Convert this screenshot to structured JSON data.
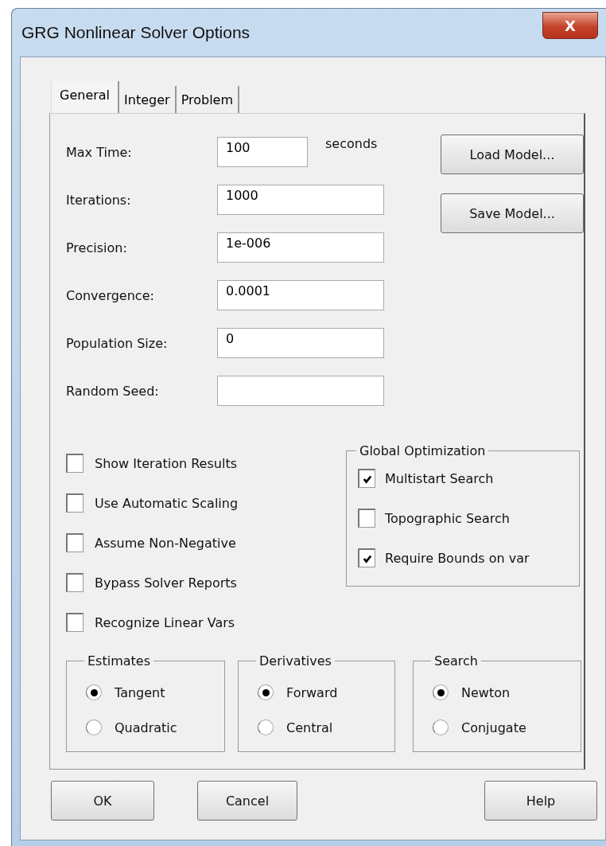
{
  "window": {
    "title": "GRG Nonlinear Solver Options",
    "close": "X"
  },
  "tabs": [
    {
      "label": "General",
      "selected": true
    },
    {
      "label": "Integer",
      "selected": false
    },
    {
      "label": "Problem",
      "selected": false
    }
  ],
  "fields": [
    {
      "label": "Max Time:",
      "value": "100",
      "suffix": "seconds"
    },
    {
      "label": "Iterations:",
      "value": "1000"
    },
    {
      "label": "Precision:",
      "value": "1e-006"
    },
    {
      "label": "Convergence:",
      "value": "0.0001"
    },
    {
      "label": "Population Size:",
      "value": "0"
    },
    {
      "label": "Random Seed:"
    }
  ],
  "side_buttons": [
    "Load Model...",
    "Save Model..."
  ],
  "options": [
    {
      "label": "Show Iteration Results",
      "checked": false
    },
    {
      "label": "Use Automatic Scaling",
      "checked": false
    },
    {
      "label": "Assume Non-Negative",
      "checked": false
    },
    {
      "label": "Bypass Solver Reports",
      "checked": false
    },
    {
      "label": "Recognize Linear Vars",
      "checked": false
    }
  ],
  "global_optimization": {
    "title": "Global Optimization",
    "options": [
      {
        "label": "Multistart Search",
        "checked": true
      },
      {
        "label": "Topographic Search",
        "checked": false
      },
      {
        "label": "Require Bounds on var",
        "checked": true
      }
    ]
  },
  "radio_groups": [
    {
      "title": "Estimates",
      "options": [
        {
          "label": "Tangent",
          "selected": true
        },
        {
          "label": "Quadratic",
          "selected": false
        }
      ]
    },
    {
      "title": "Derivatives",
      "options": [
        {
          "label": "Forward",
          "selected": true
        },
        {
          "label": "Central",
          "selected": false
        }
      ]
    },
    {
      "title": "Search",
      "options": [
        {
          "label": "Newton",
          "selected": true
        },
        {
          "label": "Conjugate",
          "selected": false
        }
      ]
    }
  ],
  "buttons": [
    "OK",
    "Cancel",
    "Help"
  ]
}
